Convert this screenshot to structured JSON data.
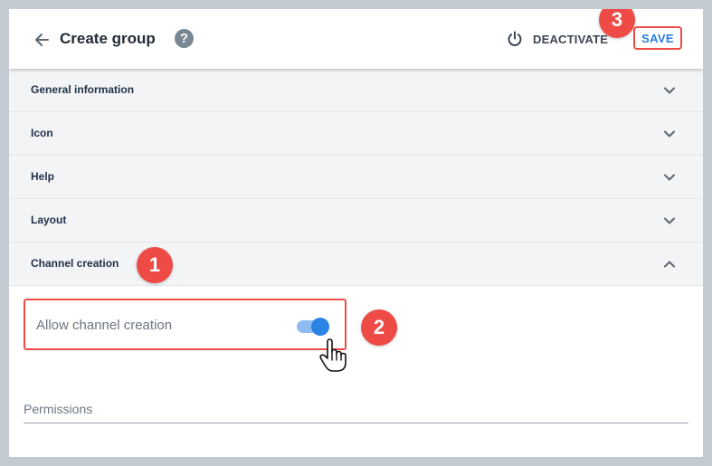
{
  "header": {
    "title": "Create group",
    "help_icon": "?",
    "deactivate_label": "DEACTIVATE",
    "save_label": "SAVE"
  },
  "sections": [
    {
      "label": "General information",
      "expanded": false
    },
    {
      "label": "Icon",
      "expanded": false
    },
    {
      "label": "Help",
      "expanded": false
    },
    {
      "label": "Layout",
      "expanded": false
    },
    {
      "label": "Channel creation",
      "expanded": true
    }
  ],
  "channel_creation": {
    "toggle_label": "Allow channel creation",
    "toggle_on": true,
    "permissions_label": "Permissions"
  },
  "badges": [
    "1",
    "2",
    "3"
  ],
  "colors": {
    "accent": "#2b83e6",
    "highlight": "#ef4b46",
    "section_bg": "#f3f4f6",
    "backdrop": "#c3cad1"
  },
  "icons": [
    "back-arrow-icon",
    "help-icon",
    "power-icon",
    "chevron-down-icon",
    "chevron-up-icon",
    "hand-cursor-icon"
  ]
}
